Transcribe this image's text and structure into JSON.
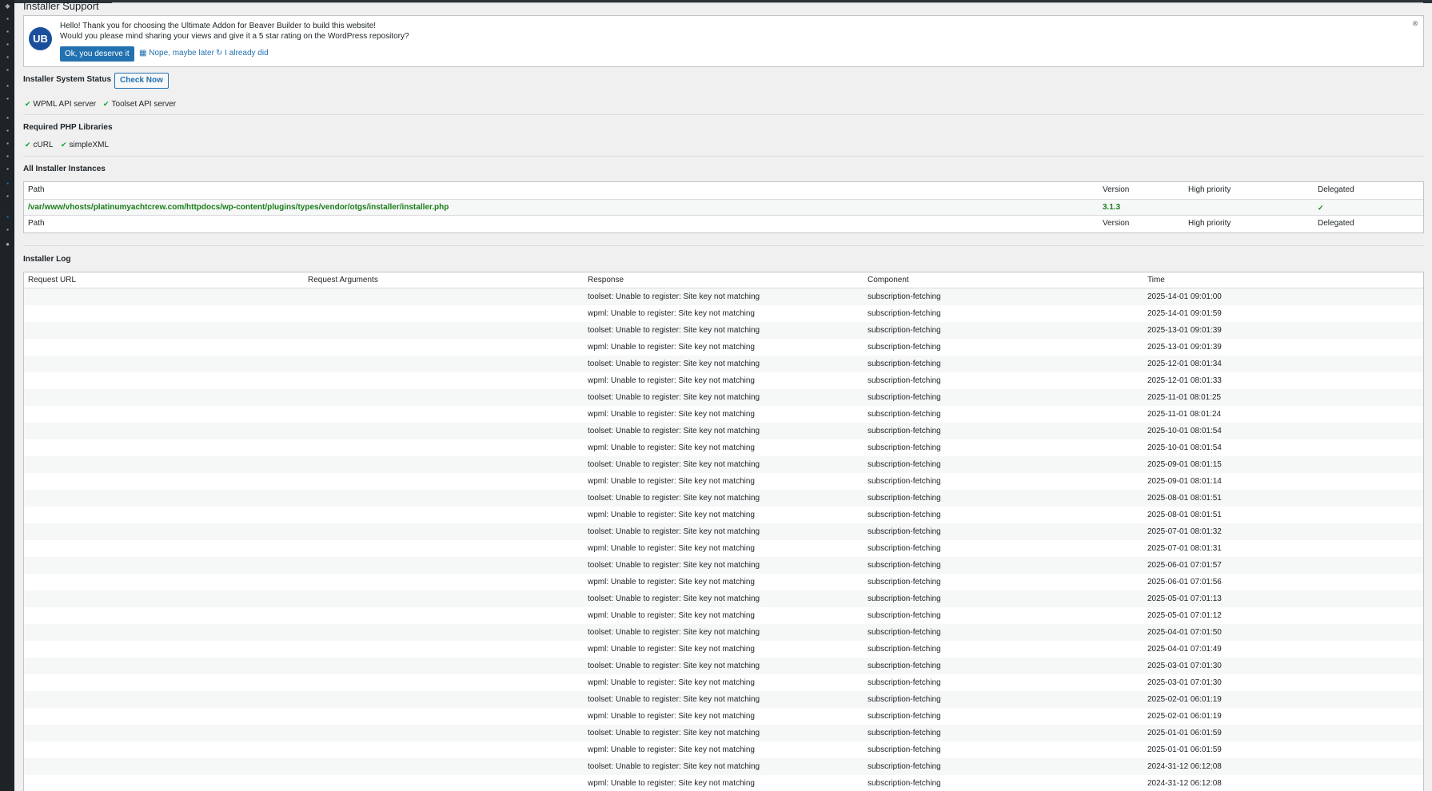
{
  "page": {
    "title": "Installer Support"
  },
  "notice": {
    "logo_text": "UB",
    "line1": "Hello! Thank you for choosing the Ultimate Addon for Beaver Builder to build this website!",
    "line2": "Would you please mind sharing your views and give it a 5 star rating on the WordPress repository?",
    "primary_button": "Ok, you deserve it",
    "nope_link": "Nope, maybe later",
    "already_link": "I already did",
    "dismiss_icon": "close-icon"
  },
  "system_status": {
    "label": "Installer System Status",
    "check_button": "Check Now",
    "items": [
      "WPML API server",
      "Toolset API server"
    ]
  },
  "php_libraries": {
    "label": "Required PHP Libraries",
    "items": [
      "cURL",
      "simpleXML"
    ]
  },
  "instances": {
    "label": "All Installer Instances",
    "headers": {
      "path": "Path",
      "version": "Version",
      "high_priority": "High priority",
      "delegated": "Delegated"
    },
    "row": {
      "path": "/var/www/vhosts/platinumyachtcrew.com/httpdocs/wp-content/plugins/types/vendor/otgs/installer/installer.php",
      "version": "3.1.3",
      "high_priority": "",
      "delegated": "✓"
    }
  },
  "log": {
    "label": "Installer Log",
    "headers": {
      "url": "Request URL",
      "args": "Request Arguments",
      "response": "Response",
      "component": "Component",
      "time": "Time"
    },
    "rows": [
      {
        "response": "toolset: Unable to register: Site key not matching",
        "component": "subscription-fetching",
        "time": "2025-14-01 09:01:00"
      },
      {
        "response": "wpml: Unable to register: Site key not matching",
        "component": "subscription-fetching",
        "time": "2025-14-01 09:01:59"
      },
      {
        "response": "toolset: Unable to register: Site key not matching",
        "component": "subscription-fetching",
        "time": "2025-13-01 09:01:39"
      },
      {
        "response": "wpml: Unable to register: Site key not matching",
        "component": "subscription-fetching",
        "time": "2025-13-01 09:01:39"
      },
      {
        "response": "toolset: Unable to register: Site key not matching",
        "component": "subscription-fetching",
        "time": "2025-12-01 08:01:34"
      },
      {
        "response": "wpml: Unable to register: Site key not matching",
        "component": "subscription-fetching",
        "time": "2025-12-01 08:01:33"
      },
      {
        "response": "toolset: Unable to register: Site key not matching",
        "component": "subscription-fetching",
        "time": "2025-11-01 08:01:25"
      },
      {
        "response": "wpml: Unable to register: Site key not matching",
        "component": "subscription-fetching",
        "time": "2025-11-01 08:01:24"
      },
      {
        "response": "toolset: Unable to register: Site key not matching",
        "component": "subscription-fetching",
        "time": "2025-10-01 08:01:54"
      },
      {
        "response": "wpml: Unable to register: Site key not matching",
        "component": "subscription-fetching",
        "time": "2025-10-01 08:01:54"
      },
      {
        "response": "toolset: Unable to register: Site key not matching",
        "component": "subscription-fetching",
        "time": "2025-09-01 08:01:15"
      },
      {
        "response": "wpml: Unable to register: Site key not matching",
        "component": "subscription-fetching",
        "time": "2025-09-01 08:01:14"
      },
      {
        "response": "toolset: Unable to register: Site key not matching",
        "component": "subscription-fetching",
        "time": "2025-08-01 08:01:51"
      },
      {
        "response": "wpml: Unable to register: Site key not matching",
        "component": "subscription-fetching",
        "time": "2025-08-01 08:01:51"
      },
      {
        "response": "toolset: Unable to register: Site key not matching",
        "component": "subscription-fetching",
        "time": "2025-07-01 08:01:32"
      },
      {
        "response": "wpml: Unable to register: Site key not matching",
        "component": "subscription-fetching",
        "time": "2025-07-01 08:01:31"
      },
      {
        "response": "toolset: Unable to register: Site key not matching",
        "component": "subscription-fetching",
        "time": "2025-06-01 07:01:57"
      },
      {
        "response": "wpml: Unable to register: Site key not matching",
        "component": "subscription-fetching",
        "time": "2025-06-01 07:01:56"
      },
      {
        "response": "toolset: Unable to register: Site key not matching",
        "component": "subscription-fetching",
        "time": "2025-05-01 07:01:13"
      },
      {
        "response": "wpml: Unable to register: Site key not matching",
        "component": "subscription-fetching",
        "time": "2025-05-01 07:01:12"
      },
      {
        "response": "toolset: Unable to register: Site key not matching",
        "component": "subscription-fetching",
        "time": "2025-04-01 07:01:50"
      },
      {
        "response": "wpml: Unable to register: Site key not matching",
        "component": "subscription-fetching",
        "time": "2025-04-01 07:01:49"
      },
      {
        "response": "toolset: Unable to register: Site key not matching",
        "component": "subscription-fetching",
        "time": "2025-03-01 07:01:30"
      },
      {
        "response": "wpml: Unable to register: Site key not matching",
        "component": "subscription-fetching",
        "time": "2025-03-01 07:01:30"
      },
      {
        "response": "toolset: Unable to register: Site key not matching",
        "component": "subscription-fetching",
        "time": "2025-02-01 06:01:19"
      },
      {
        "response": "wpml: Unable to register: Site key not matching",
        "component": "subscription-fetching",
        "time": "2025-02-01 06:01:19"
      },
      {
        "response": "toolset: Unable to register: Site key not matching",
        "component": "subscription-fetching",
        "time": "2025-01-01 06:01:59"
      },
      {
        "response": "wpml: Unable to register: Site key not matching",
        "component": "subscription-fetching",
        "time": "2025-01-01 06:01:59"
      },
      {
        "response": "toolset: Unable to register: Site key not matching",
        "component": "subscription-fetching",
        "time": "2024-31-12 06:12:08"
      },
      {
        "response": "wpml: Unable to register: Site key not matching",
        "component": "subscription-fetching",
        "time": "2024-31-12 06:12:08"
      }
    ]
  },
  "colors": {
    "accent": "#2271b1",
    "success": "#00a32a",
    "path_green": "#1a7d1a",
    "sidebar": "#1d2327"
  }
}
